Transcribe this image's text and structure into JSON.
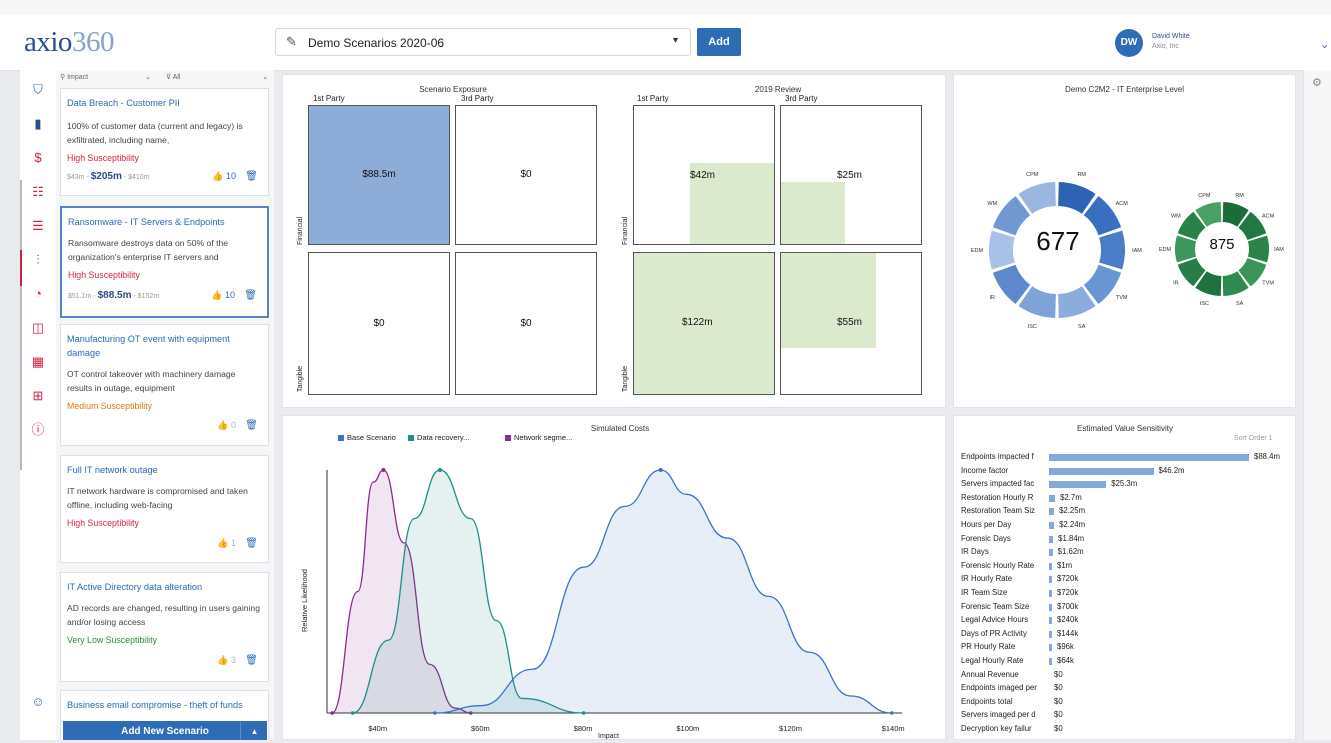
{
  "header": {
    "logo_main": "axio",
    "logo_num": "360",
    "scenario_select_value": "Demo Scenarios 2020-06",
    "add_label": "Add",
    "avatar_initials": "DW",
    "user_name": "David White",
    "user_org": "Axio, Inc"
  },
  "filters": {
    "impact": "Impact",
    "all": "All"
  },
  "scenarios": [
    {
      "title": "Data Breach - Customer PII",
      "desc": "100% of customer data (current and legacy) is exfiltrated, including name,",
      "susceptibility": "High Susceptibility",
      "sus_color": "#d6243f",
      "low": "$43m",
      "mid": "$205m",
      "high": "$410m",
      "votes": "10"
    },
    {
      "title": "Ransomware - IT Servers & Endpoints",
      "desc": "Ransomware destroys data on 50% of the organization's enterprise IT servers and",
      "susceptibility": "High Susceptibility",
      "sus_color": "#d6243f",
      "low": "$51.1m",
      "mid": "$88.5m",
      "high": "$152m",
      "votes": "10"
    },
    {
      "title": "Manufacturing OT event with equipment damage",
      "desc": "OT control takeover with machinery damage results in outage, equipment",
      "susceptibility": "Medium Susceptibility",
      "sus_color": "#e07a1d",
      "votes": "0"
    },
    {
      "title": "Full IT network outage",
      "desc": "IT network hardware is compromised and taken offline, including web-facing",
      "susceptibility": "High Susceptibility",
      "sus_color": "#d6243f",
      "votes": "1"
    },
    {
      "title": "IT Active Directory data alteration",
      "desc": "AD records are changed, resulting in users gaining and/or losing access",
      "susceptibility": "Very Low Susceptibility",
      "sus_color": "#2e8b3e",
      "votes": "3"
    },
    {
      "title": "Business email compromise - theft of funds"
    }
  ],
  "add_new_scenario": "Add New Scenario",
  "exposure": {
    "title": "Scenario Exposure",
    "col1": "1st Party",
    "col2": "3rd Party",
    "row1": "Financial",
    "row2": "Tangible",
    "values": [
      "$88.5m",
      "$0",
      "$0",
      "$0"
    ]
  },
  "review": {
    "title": "2019 Review",
    "col1": "1st Party",
    "col2": "3rd Party",
    "row1": "Financial",
    "row2": "Tangible",
    "values": [
      "$42m",
      "$25m",
      "$122m",
      "$55m"
    ]
  },
  "c2m2": {
    "title": "Demo C2M2 - IT Enterprise Level",
    "score_blue": "677",
    "score_green": "875",
    "blue_labels": [
      "RM",
      "ACM",
      "IAM",
      "TVM",
      "SA",
      "ISC",
      "IR",
      "EDM",
      "WM",
      "CPM"
    ],
    "green_labels": [
      "RM",
      "ACM",
      "IAM",
      "TVM",
      "SA",
      "ISC",
      "IR",
      "EDM",
      "WM",
      "CPM"
    ]
  },
  "chart_data": {
    "type": "area",
    "title": "Simulated Costs",
    "xlabel": "Impact",
    "ylabel": "Relative Likelihood",
    "x_ticks": [
      "$40m",
      "$60m",
      "$80m",
      "$100m",
      "$120m",
      "$140m"
    ],
    "xlim": [
      30,
      142
    ],
    "series": [
      {
        "name": "Base Scenario",
        "color": "#3b73c8",
        "x": [
          51,
          60,
          70,
          80,
          88,
          95,
          100,
          108,
          116,
          124,
          132,
          140
        ],
        "y": [
          0,
          0.03,
          0.18,
          0.6,
          0.85,
          1.0,
          0.9,
          0.72,
          0.48,
          0.25,
          0.07,
          0
        ]
      },
      {
        "name": "Data recovery...",
        "color": "#1e8f86",
        "x": [
          35,
          42,
          47,
          52,
          58,
          63,
          68,
          80
        ],
        "y": [
          0,
          0.3,
          0.8,
          1.0,
          0.8,
          0.38,
          0.06,
          0
        ]
      },
      {
        "name": "Network segme...",
        "color": "#8a2c8a",
        "x": [
          31,
          36,
          39,
          41,
          45,
          50,
          55,
          58
        ],
        "y": [
          0,
          0.5,
          0.95,
          1.0,
          0.7,
          0.2,
          0.02,
          0
        ]
      }
    ]
  },
  "sensitivity": {
    "title": "Estimated Value Sensitivity",
    "sort_label": "Sort Order 1",
    "rows": [
      {
        "label": "Endpoints impacted f",
        "value": 88.4,
        "text": "$88.4m"
      },
      {
        "label": "Income factor",
        "value": 46.2,
        "text": "$46.2m"
      },
      {
        "label": "Servers impacted fac",
        "value": 25.3,
        "text": "$25.3m"
      },
      {
        "label": "Restoration Hourly R",
        "value": 2.7,
        "text": "$2.7m"
      },
      {
        "label": "Restoration Team Siz",
        "value": 2.25,
        "text": "$2.25m"
      },
      {
        "label": "Hours per Day",
        "value": 2.24,
        "text": "$2.24m"
      },
      {
        "label": "Forensic Days",
        "value": 1.84,
        "text": "$1.84m"
      },
      {
        "label": "IR Days",
        "value": 1.62,
        "text": "$1.62m"
      },
      {
        "label": "Forensic Hourly Rate",
        "value": 1.0,
        "text": "$1m"
      },
      {
        "label": "IR Hourly Rate",
        "value": 0.72,
        "text": "$720k"
      },
      {
        "label": "IR Team Size",
        "value": 0.72,
        "text": "$720k"
      },
      {
        "label": "Forensic Team Size",
        "value": 0.7,
        "text": "$700k"
      },
      {
        "label": "Legal Advice Hours",
        "value": 0.24,
        "text": "$240k"
      },
      {
        "label": "Days of PR Activity",
        "value": 0.144,
        "text": "$144k"
      },
      {
        "label": "PR Hourly Rate",
        "value": 0.096,
        "text": "$96k"
      },
      {
        "label": "Legal Hourly Rate",
        "value": 0.064,
        "text": "$64k"
      },
      {
        "label": "Annual Revenue",
        "value": 0,
        "text": "$0"
      },
      {
        "label": "Endpoints imaged per",
        "value": 0,
        "text": "$0"
      },
      {
        "label": "Endpoints total",
        "value": 0,
        "text": "$0"
      },
      {
        "label": "Servers imaged per d",
        "value": 0,
        "text": "$0"
      },
      {
        "label": "Decryption key failur",
        "value": 0,
        "text": "$0"
      }
    ]
  }
}
